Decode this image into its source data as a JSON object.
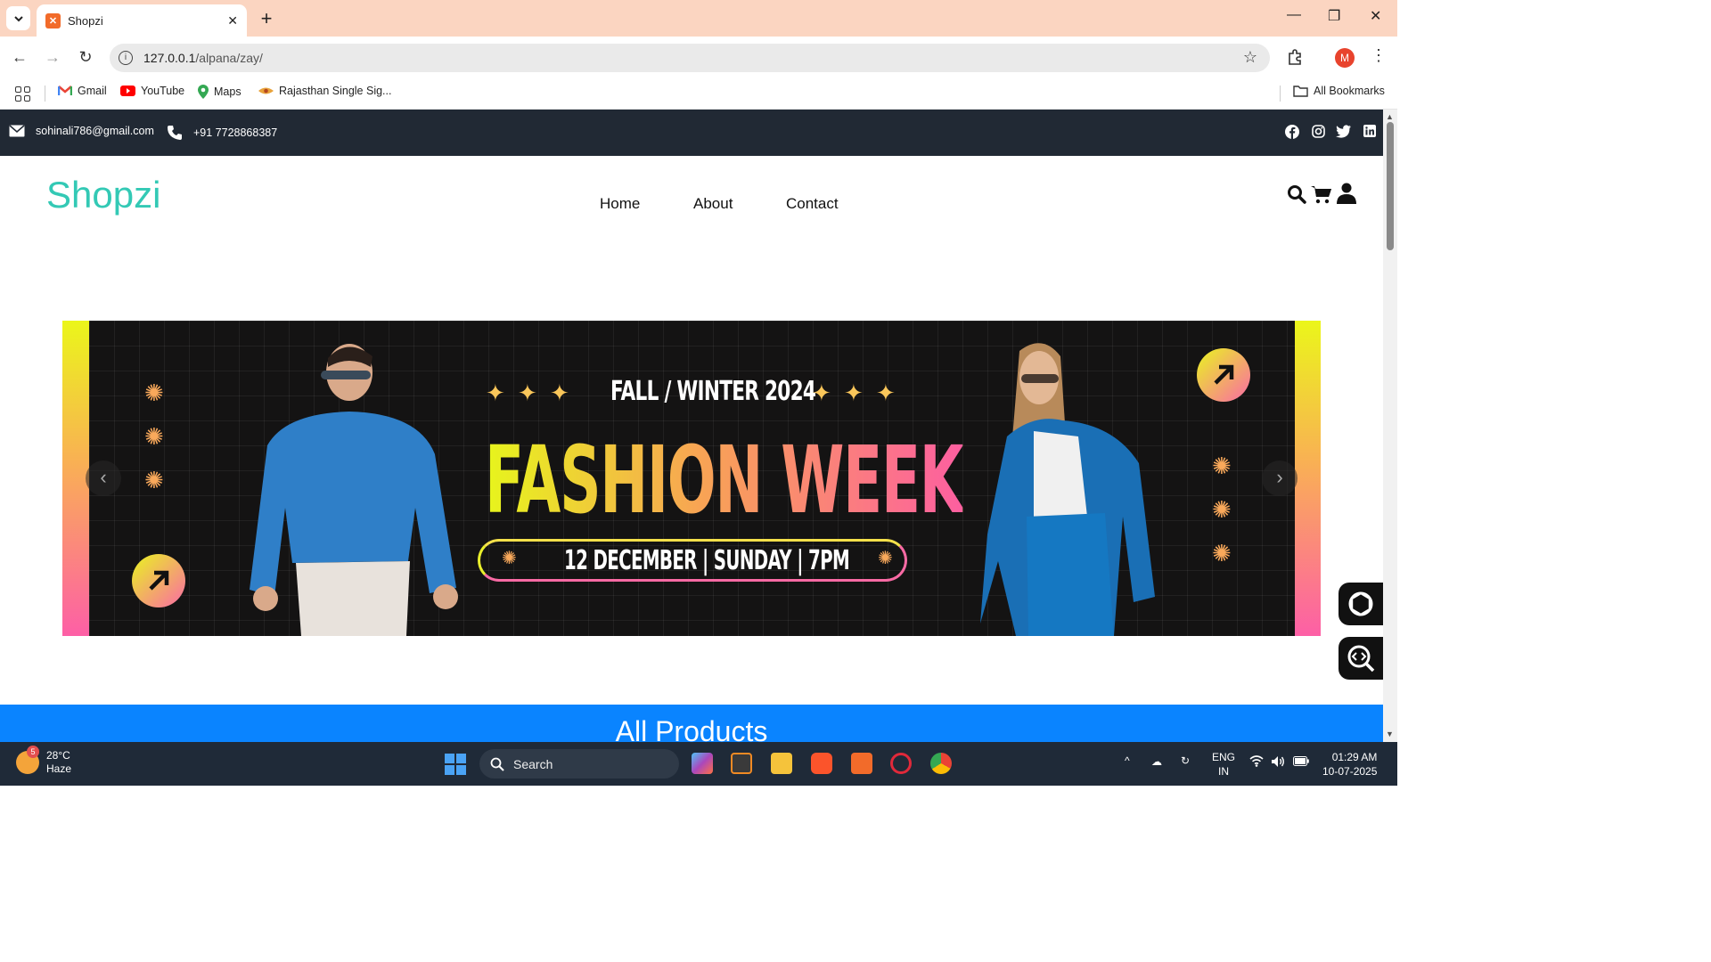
{
  "browser": {
    "tab_title": "Shopzi",
    "url_host": "127.0.0.1",
    "url_path": "/alpana/zay/",
    "bookmarks": [
      "Gmail",
      "YouTube",
      "Maps",
      "Rajasthan Single Sig..."
    ],
    "all_bookmarks": "All Bookmarks",
    "profile_initial": "M"
  },
  "topbar": {
    "email": "sohinali786@gmail.com",
    "phone": "+91 7728868387"
  },
  "header": {
    "logo": "Shopzi",
    "nav": [
      "Home",
      "About",
      "Contact"
    ]
  },
  "banner": {
    "subtitle": "FALL / WINTER 2024",
    "title": "FASHION WEEK",
    "date": "12 DECEMBER | SUNDAY | 7PM"
  },
  "section": {
    "title": "All Products"
  },
  "taskbar": {
    "weather_temp": "28°C",
    "weather_desc": "Haze",
    "weather_badge": "5",
    "search_label": "Search",
    "lang": "ENG",
    "region": "IN",
    "time": "01:29 AM",
    "date": "10-07-2025"
  },
  "colors": {
    "topbar_bg": "#212934",
    "logo": "#33c9b5",
    "section_bg": "#0a84ff",
    "tab_strip": "#fbd5c1"
  }
}
